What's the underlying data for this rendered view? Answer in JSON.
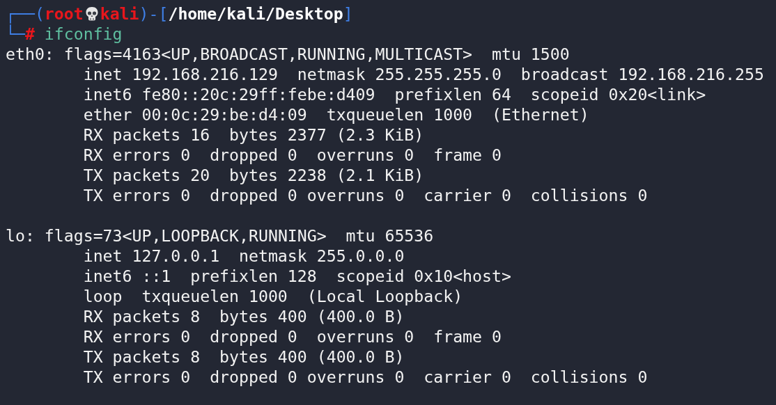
{
  "prompt": {
    "open": "┌──(",
    "user": "root",
    "host": "kali",
    "sep": ")-[",
    "path": "/home/kali/Desktop",
    "close": "]",
    "corner": "└─",
    "symbol": "#"
  },
  "command": "ifconfig",
  "interfaces": [
    {
      "header": "eth0: flags=4163<UP,BROADCAST,RUNNING,MULTICAST>  mtu 1500",
      "lines": [
        "inet 192.168.216.129  netmask 255.255.255.0  broadcast 192.168.216.255",
        "inet6 fe80::20c:29ff:febe:d409  prefixlen 64  scopeid 0x20<link>",
        "ether 00:0c:29:be:d4:09  txqueuelen 1000  (Ethernet)",
        "RX packets 16  bytes 2377 (2.3 KiB)",
        "RX errors 0  dropped 0  overruns 0  frame 0",
        "TX packets 20  bytes 2238 (2.1 KiB)",
        "TX errors 0  dropped 0 overruns 0  carrier 0  collisions 0"
      ]
    },
    {
      "header": "lo: flags=73<UP,LOOPBACK,RUNNING>  mtu 65536",
      "lines": [
        "inet 127.0.0.1  netmask 255.0.0.0",
        "inet6 ::1  prefixlen 128  scopeid 0x10<host>",
        "loop  txqueuelen 1000  (Local Loopback)",
        "RX packets 8  bytes 400 (400.0 B)",
        "RX errors 0  dropped 0  overruns 0  frame 0",
        "TX packets 8  bytes 400 (400.0 B)",
        "TX errors 0  dropped 0 overruns 0  carrier 0  collisions 0"
      ]
    }
  ]
}
